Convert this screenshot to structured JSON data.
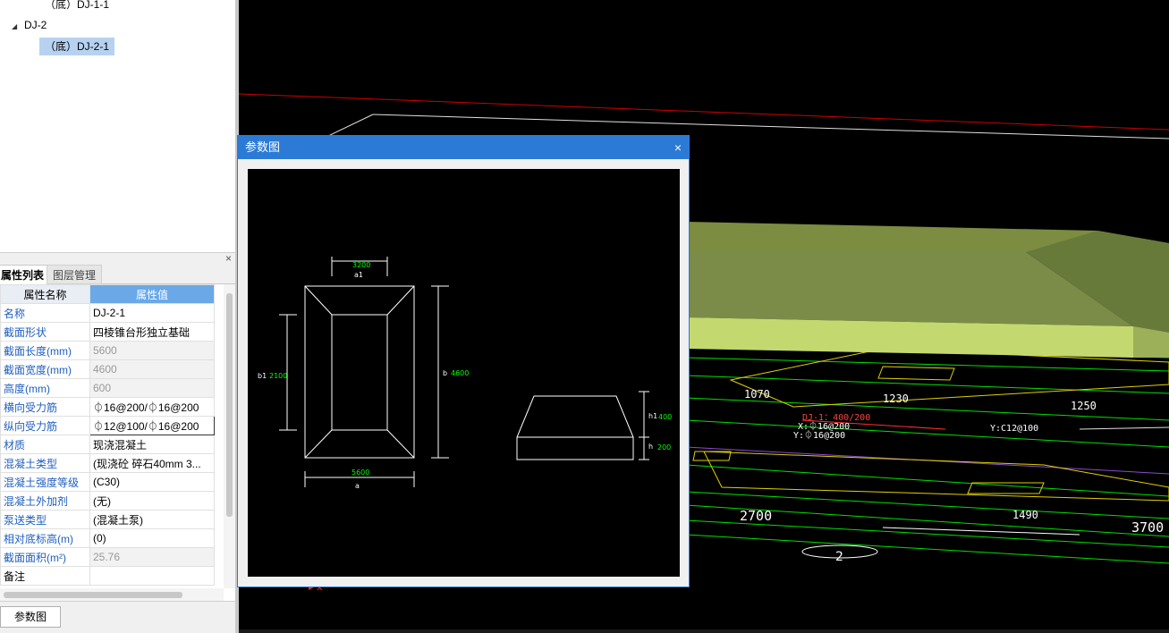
{
  "tree": {
    "item1": "（底）DJ-1-1",
    "group": "DJ-2",
    "item2": "（底）DJ-2-1"
  },
  "panel": {
    "close": "×",
    "tab_active": "属性列表",
    "tab_inactive": "图层管理"
  },
  "props": {
    "header_name": "属性名称",
    "header_value": "属性值",
    "rows": [
      {
        "name": "名称",
        "value": "DJ-2-1"
      },
      {
        "name": "截面形状",
        "value": "四棱锥台形独立基础"
      },
      {
        "name": "截面长度(mm)",
        "value": "5600"
      },
      {
        "name": "截面宽度(mm)",
        "value": "4600"
      },
      {
        "name": "高度(mm)",
        "value": "600"
      },
      {
        "name": "横向受力筋",
        "value": "⏀16@200/⏀16@200"
      },
      {
        "name": "纵向受力筋",
        "value": "⏀12@100/⏀16@200"
      },
      {
        "name": "材质",
        "value": "现浇混凝土"
      },
      {
        "name": "混凝土类型",
        "value": "(现浇砼 碎石40mm 3..."
      },
      {
        "name": "混凝土强度等级",
        "value": "(C30)"
      },
      {
        "name": "混凝土外加剂",
        "value": "(无)"
      },
      {
        "name": "泵送类型",
        "value": "(混凝土泵)"
      },
      {
        "name": "相对底标高(m)",
        "value": "(0)"
      },
      {
        "name": "截面面积(m²)",
        "value": "25.76"
      },
      {
        "name": "备注",
        "value": ""
      }
    ]
  },
  "bottom": {
    "button": "参数图"
  },
  "dialog": {
    "title": "参数图",
    "close": "×",
    "drawing": {
      "a1_value": "3200",
      "a1_label": "a1",
      "b1_label": "b1",
      "b1_value": "2100",
      "b_label": "b",
      "b_value": "4600",
      "a_value": "5600",
      "a_label": "a",
      "h1_label": "h1",
      "h1_value": "400",
      "h_label": "h",
      "h_value": "200"
    }
  },
  "view3d": {
    "dims": [
      "1070",
      "1230",
      "1250",
      "2700",
      "1490",
      "3700"
    ],
    "axis_label": "2",
    "annotation1": "DJ-1：400/200",
    "annotation2": "X:⏀16@200",
    "annotation3": "Y:⏀16@200",
    "annotation4": "Y:C12@100"
  },
  "colors": {
    "accent": "#2b7bd6",
    "header_value_bg": "#6aa8e8",
    "prop_name": "#1f5fbf",
    "dim_green": "#00ff00",
    "foundation_top": "#8a9a4a",
    "foundation_side": "#c8d870"
  }
}
